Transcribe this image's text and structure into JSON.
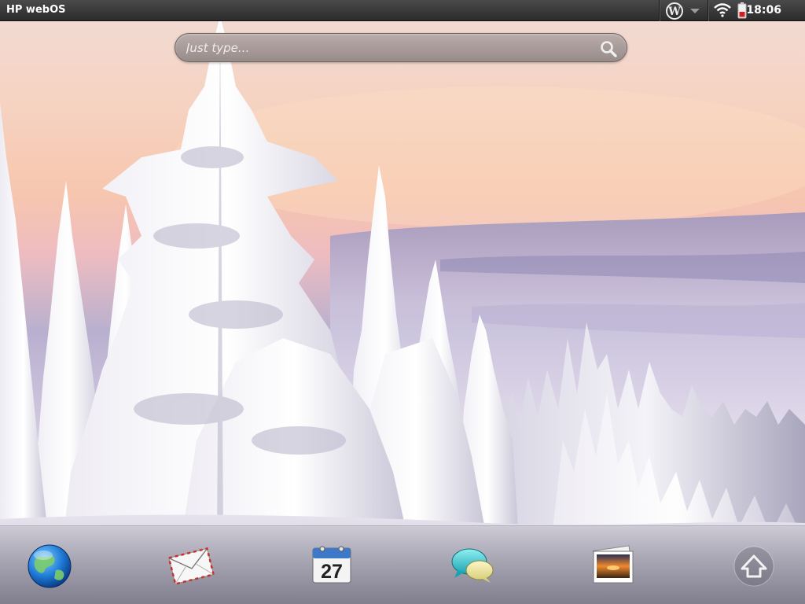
{
  "status_bar": {
    "app_title": "HP webOS",
    "clock": "18:06",
    "icons": [
      "wordpress-icon",
      "wifi-icon",
      "battery-icon"
    ]
  },
  "search": {
    "placeholder": "Just type...",
    "value": ""
  },
  "dock": {
    "apps": [
      {
        "icon": "web-browser-icon"
      },
      {
        "icon": "email-icon"
      },
      {
        "icon": "calendar-icon",
        "day": "27"
      },
      {
        "icon": "messaging-icon"
      },
      {
        "icon": "photos-icon"
      }
    ],
    "launcher_icon": "launcher-up-arrow-icon"
  },
  "colors": {
    "status_bar": "#333333",
    "battery_low": "#d21e1e",
    "search_bar": "#a89c9a"
  }
}
